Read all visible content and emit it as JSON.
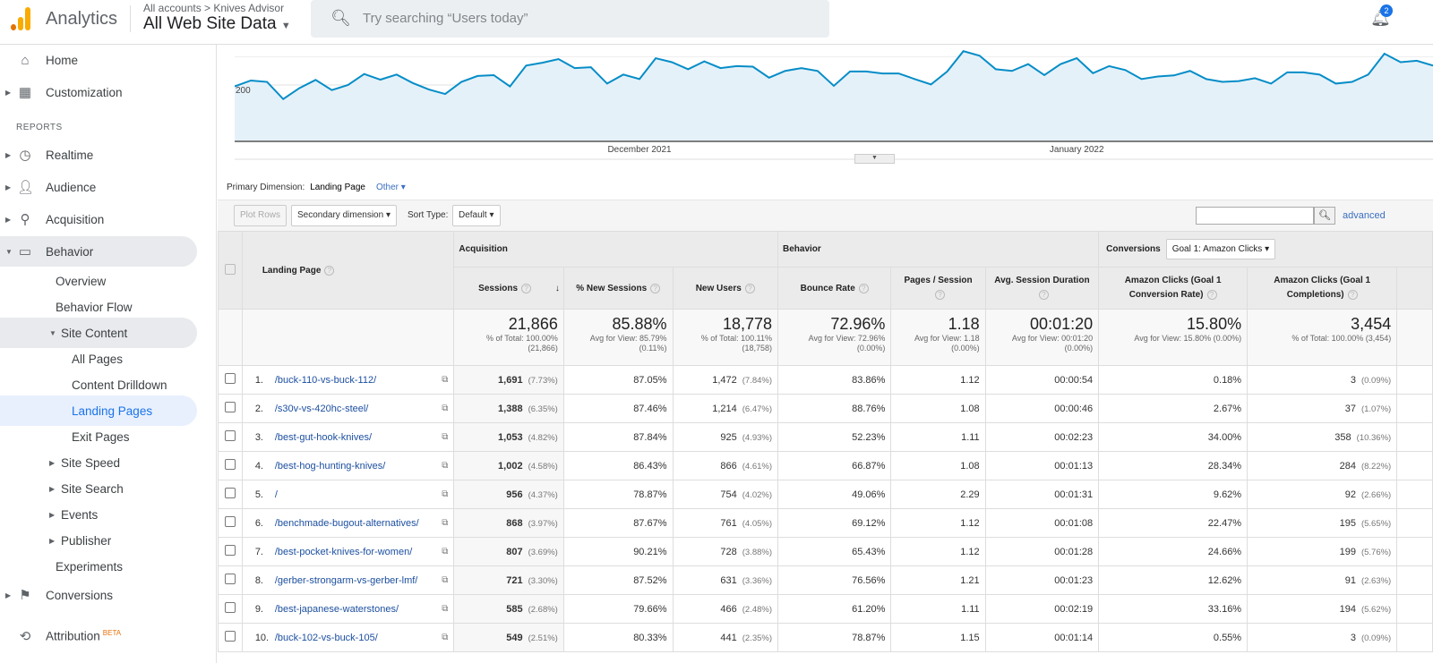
{
  "header": {
    "app_name": "Analytics",
    "breadcrumb": "All accounts > Knives Advisor",
    "property": "All Web Site Data",
    "search_placeholder": "Try searching “Users today”",
    "notifications": "2",
    "colors": {
      "logo_orange": "#f9ab00",
      "logo_dark": "#e37400"
    }
  },
  "sidebar": {
    "reports_label": "REPORTS",
    "items": [
      {
        "label": "Home",
        "icon": "home-icon"
      },
      {
        "label": "Customization",
        "icon": "dashboard-icon"
      },
      {
        "label": "Realtime",
        "icon": "clock-icon"
      },
      {
        "label": "Audience",
        "icon": "person-icon"
      },
      {
        "label": "Acquisition",
        "icon": "acquisition-icon"
      },
      {
        "label": "Behavior",
        "icon": "behavior-icon"
      },
      {
        "label": "Overview"
      },
      {
        "label": "Behavior Flow"
      },
      {
        "label": "Site Content"
      },
      {
        "label": "All Pages"
      },
      {
        "label": "Content Drilldown"
      },
      {
        "label": "Landing Pages"
      },
      {
        "label": "Exit Pages"
      },
      {
        "label": "Site Speed"
      },
      {
        "label": "Site Search"
      },
      {
        "label": "Events"
      },
      {
        "label": "Publisher"
      },
      {
        "label": "Experiments"
      },
      {
        "label": "Conversions",
        "icon": "flag-icon"
      },
      {
        "label": "Attribution",
        "icon": "attribution-icon",
        "badge": "BETA"
      }
    ]
  },
  "chart_data": {
    "type": "area",
    "y_tick_label": "200",
    "x_tick_labels": [
      {
        "label": "December 2021",
        "index": 25
      },
      {
        "label": "January 2022",
        "index": 52
      }
    ],
    "color": "#058dc7",
    "fill": "#e5f1f9",
    "values": [
      195,
      216,
      211,
      150,
      189,
      218,
      182,
      200,
      239,
      219,
      237,
      207,
      184,
      168,
      211,
      232,
      235,
      195,
      269,
      279,
      292,
      260,
      263,
      205,
      237,
      221,
      295,
      281,
      256,
      284,
      260,
      267,
      265,
      226,
      250,
      260,
      250,
      197,
      248,
      248,
      241,
      241,
      221,
      202,
      248,
      320,
      304,
      256,
      250,
      274,
      235,
      274,
      295,
      242,
      267,
      253,
      221,
      230,
      234,
      250,
      221,
      211,
      214,
      224,
      205,
      245,
      245,
      237,
      205,
      211,
      237,
      311,
      281,
      286,
      269
    ]
  },
  "dimension": {
    "label": "Primary Dimension:",
    "value": "Landing Page",
    "other": "Other"
  },
  "toolbar": {
    "plot_rows": "Plot Rows",
    "secondary": "Secondary dimension",
    "sort_label": "Sort Type:",
    "sort_value": "Default",
    "advanced": "advanced"
  },
  "table": {
    "groups": {
      "acquisition": "Acquisition",
      "behavior": "Behavior",
      "conversions": "Conversions",
      "goal_select": "Goal 1: Amazon Clicks"
    },
    "columns": [
      "Landing Page",
      "Sessions",
      "% New Sessions",
      "New Users",
      "Bounce Rate",
      "Pages / Session",
      "Avg. Session Duration",
      "Amazon Clicks (Goal 1 Conversion Rate)",
      "Amazon Clicks (Goal 1 Completions)"
    ],
    "totals": [
      {
        "value": "21,866",
        "sub": "% of Total: 100.00% (21,866)"
      },
      {
        "value": "85.88%",
        "sub": "Avg for View: 85.79% (0.11%)"
      },
      {
        "value": "18,778",
        "sub": "% of Total: 100.11% (18,758)"
      },
      {
        "value": "72.96%",
        "sub": "Avg for View: 72.96% (0.00%)"
      },
      {
        "value": "1.18",
        "sub": "Avg for View: 1.18 (0.00%)"
      },
      {
        "value": "00:01:20",
        "sub": "Avg for View: 00:01:20 (0.00%)"
      },
      {
        "value": "15.80%",
        "sub": "Avg for View: 15.80% (0.00%)"
      },
      {
        "value": "3,454",
        "sub": "% of Total: 100.00% (3,454)"
      }
    ],
    "rows": [
      {
        "n": "1.",
        "page": "/buck-110-vs-buck-112/",
        "sessions": "1,691",
        "sp": "(7.73%)",
        "new_pct": "87.05%",
        "users": "1,472",
        "up": "(7.84%)",
        "bounce": "83.86%",
        "pps": "1.12",
        "dur": "00:00:54",
        "conv": "0.18%",
        "comp": "3",
        "cp": "(0.09%)"
      },
      {
        "n": "2.",
        "page": "/s30v-vs-420hc-steel/",
        "sessions": "1,388",
        "sp": "(6.35%)",
        "new_pct": "87.46%",
        "users": "1,214",
        "up": "(6.47%)",
        "bounce": "88.76%",
        "pps": "1.08",
        "dur": "00:00:46",
        "conv": "2.67%",
        "comp": "37",
        "cp": "(1.07%)"
      },
      {
        "n": "3.",
        "page": "/best-gut-hook-knives/",
        "sessions": "1,053",
        "sp": "(4.82%)",
        "new_pct": "87.84%",
        "users": "925",
        "up": "(4.93%)",
        "bounce": "52.23%",
        "pps": "1.11",
        "dur": "00:02:23",
        "conv": "34.00%",
        "comp": "358",
        "cp": "(10.36%)"
      },
      {
        "n": "4.",
        "page": "/best-hog-hunting-knives/",
        "sessions": "1,002",
        "sp": "(4.58%)",
        "new_pct": "86.43%",
        "users": "866",
        "up": "(4.61%)",
        "bounce": "66.87%",
        "pps": "1.08",
        "dur": "00:01:13",
        "conv": "28.34%",
        "comp": "284",
        "cp": "(8.22%)"
      },
      {
        "n": "5.",
        "page": "/",
        "sessions": "956",
        "sp": "(4.37%)",
        "new_pct": "78.87%",
        "users": "754",
        "up": "(4.02%)",
        "bounce": "49.06%",
        "pps": "2.29",
        "dur": "00:01:31",
        "conv": "9.62%",
        "comp": "92",
        "cp": "(2.66%)"
      },
      {
        "n": "6.",
        "page": "/benchmade-bugout-alternatives/",
        "sessions": "868",
        "sp": "(3.97%)",
        "new_pct": "87.67%",
        "users": "761",
        "up": "(4.05%)",
        "bounce": "69.12%",
        "pps": "1.12",
        "dur": "00:01:08",
        "conv": "22.47%",
        "comp": "195",
        "cp": "(5.65%)"
      },
      {
        "n": "7.",
        "page": "/best-pocket-knives-for-women/",
        "sessions": "807",
        "sp": "(3.69%)",
        "new_pct": "90.21%",
        "users": "728",
        "up": "(3.88%)",
        "bounce": "65.43%",
        "pps": "1.12",
        "dur": "00:01:28",
        "conv": "24.66%",
        "comp": "199",
        "cp": "(5.76%)"
      },
      {
        "n": "8.",
        "page": "/gerber-strongarm-vs-gerber-lmf/",
        "sessions": "721",
        "sp": "(3.30%)",
        "new_pct": "87.52%",
        "users": "631",
        "up": "(3.36%)",
        "bounce": "76.56%",
        "pps": "1.21",
        "dur": "00:01:23",
        "conv": "12.62%",
        "comp": "91",
        "cp": "(2.63%)"
      },
      {
        "n": "9.",
        "page": "/best-japanese-waterstones/",
        "sessions": "585",
        "sp": "(2.68%)",
        "new_pct": "79.66%",
        "users": "466",
        "up": "(2.48%)",
        "bounce": "61.20%",
        "pps": "1.11",
        "dur": "00:02:19",
        "conv": "33.16%",
        "comp": "194",
        "cp": "(5.62%)"
      },
      {
        "n": "10.",
        "page": "/buck-102-vs-buck-105/",
        "sessions": "549",
        "sp": "(2.51%)",
        "new_pct": "80.33%",
        "users": "441",
        "up": "(2.35%)",
        "bounce": "78.87%",
        "pps": "1.15",
        "dur": "00:01:14",
        "conv": "0.55%",
        "comp": "3",
        "cp": "(0.09%)"
      }
    ]
  }
}
